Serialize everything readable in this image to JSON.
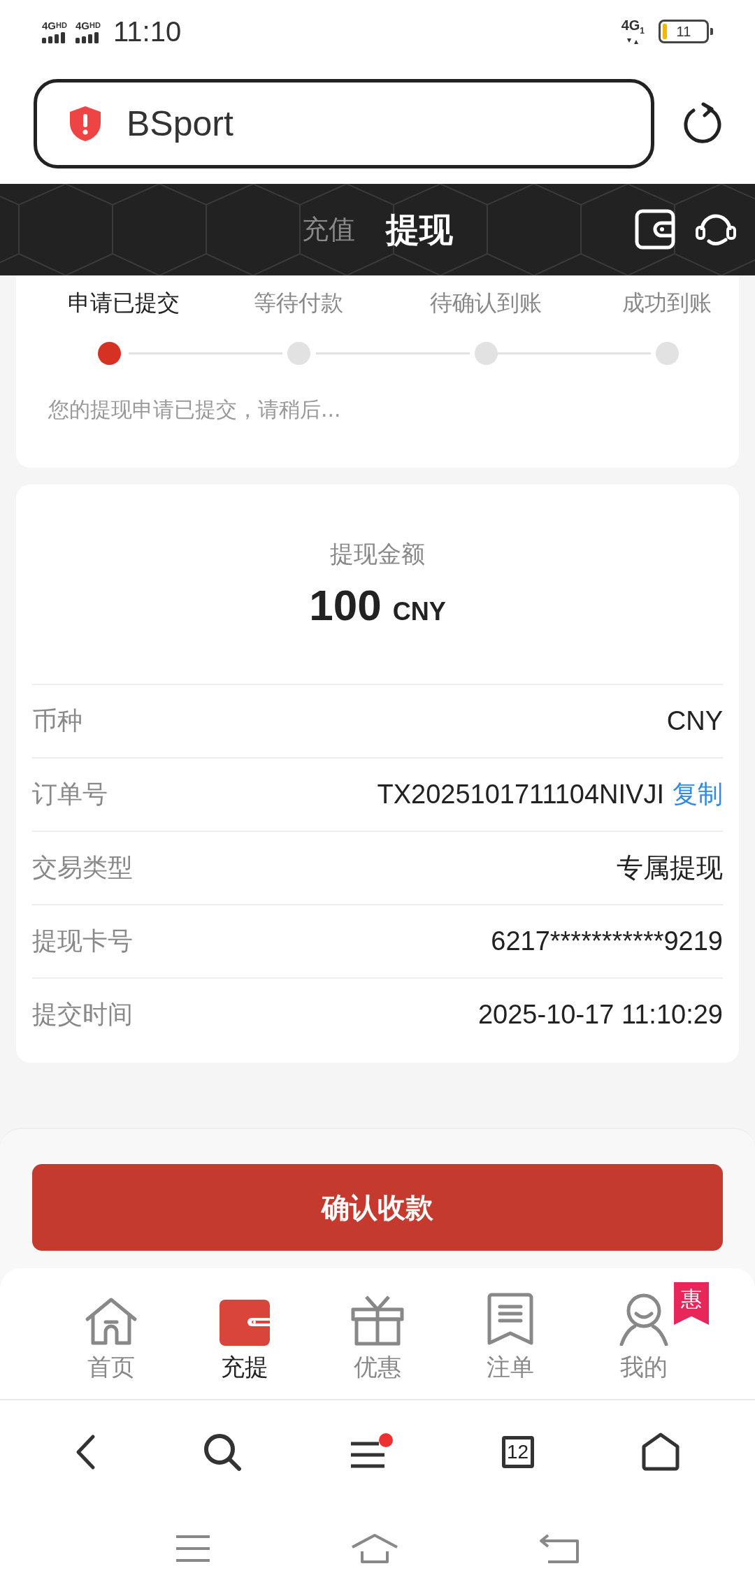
{
  "status_bar": {
    "sims": [
      {
        "network": "4G",
        "badge": "HD"
      },
      {
        "network": "4G",
        "badge": "HD"
      }
    ],
    "time": "11:10",
    "data_network": "4G",
    "data_slot": "1",
    "battery": "11"
  },
  "address_bar": {
    "url": "BSport"
  },
  "header": {
    "tabs": [
      {
        "label": "充值",
        "selected": false
      },
      {
        "label": "提现",
        "selected": true
      }
    ]
  },
  "progress": {
    "steps": [
      {
        "label": "申请已提交",
        "active": true
      },
      {
        "label": "等待付款",
        "active": false
      },
      {
        "label": "待确认到账",
        "active": false
      },
      {
        "label": "成功到账",
        "active": false
      }
    ],
    "message": "您的提现申请已提交，请稍后..."
  },
  "amount": {
    "label": "提现金额",
    "value": "100",
    "currency": "CNY"
  },
  "details": [
    {
      "label": "币种",
      "value": "CNY"
    },
    {
      "label": "订单号",
      "value": "TX2025101711104NIVJI",
      "action": "复制"
    },
    {
      "label": "交易类型",
      "value": "专属提现"
    },
    {
      "label": "提现卡号",
      "value": "6217***********9219"
    },
    {
      "label": "提交时间",
      "value": "2025-10-17 11:10:29"
    }
  ],
  "confirm_button": "确认收款",
  "tab_bar": [
    {
      "kind": "home",
      "label": "首页",
      "selected": false
    },
    {
      "kind": "wallet",
      "label": "充提",
      "selected": true
    },
    {
      "kind": "gift",
      "label": "优惠",
      "selected": false
    },
    {
      "kind": "bets",
      "label": "注单",
      "selected": false
    },
    {
      "kind": "profile",
      "label": "我的",
      "selected": false,
      "badge": "惠"
    }
  ],
  "browser_bar": {
    "tab_count": "12",
    "menu_dot": true
  }
}
